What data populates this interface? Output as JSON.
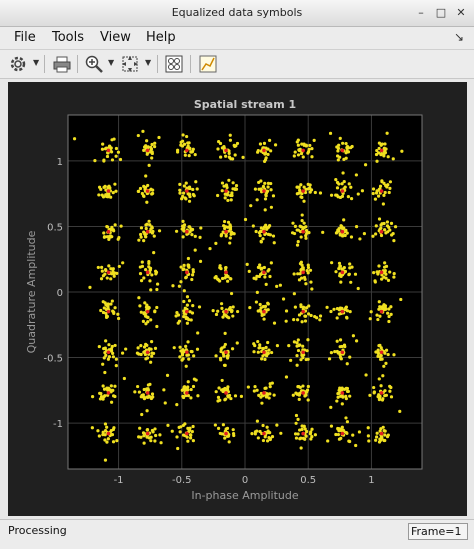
{
  "window": {
    "title": "Equalized data symbols"
  },
  "menu": [
    "File",
    "Tools",
    "View",
    "Help"
  ],
  "statusbar": {
    "status": "Processing",
    "frame": "Frame=1"
  },
  "colors": {
    "points": "#f0e020",
    "reference": "#e02020",
    "axes_bg": "#000000",
    "figure_bg": "#202020"
  },
  "chart_data": {
    "type": "scatter",
    "title": "Spatial stream 1",
    "xlabel": "In-phase Amplitude",
    "ylabel": "Quadrature Amplitude",
    "xlim": [
      -1.4,
      1.4
    ],
    "ylim": [
      -1.35,
      1.35
    ],
    "xticks": [
      -1,
      -0.5,
      0,
      0.5,
      1
    ],
    "yticks": [
      -1,
      -0.5,
      0,
      0.5,
      1
    ],
    "xtick_labels": [
      "-1",
      "-0.5",
      "0",
      "0.5",
      "1"
    ],
    "ytick_labels": [
      "-1",
      "-0.5",
      "0",
      "0.5",
      "1"
    ],
    "grid": true,
    "constellation_levels": [
      -1.08,
      -0.77,
      -0.46,
      -0.15,
      0.15,
      0.46,
      0.77,
      1.08
    ],
    "points_per_cluster": 25,
    "noise_std": 0.035
  }
}
